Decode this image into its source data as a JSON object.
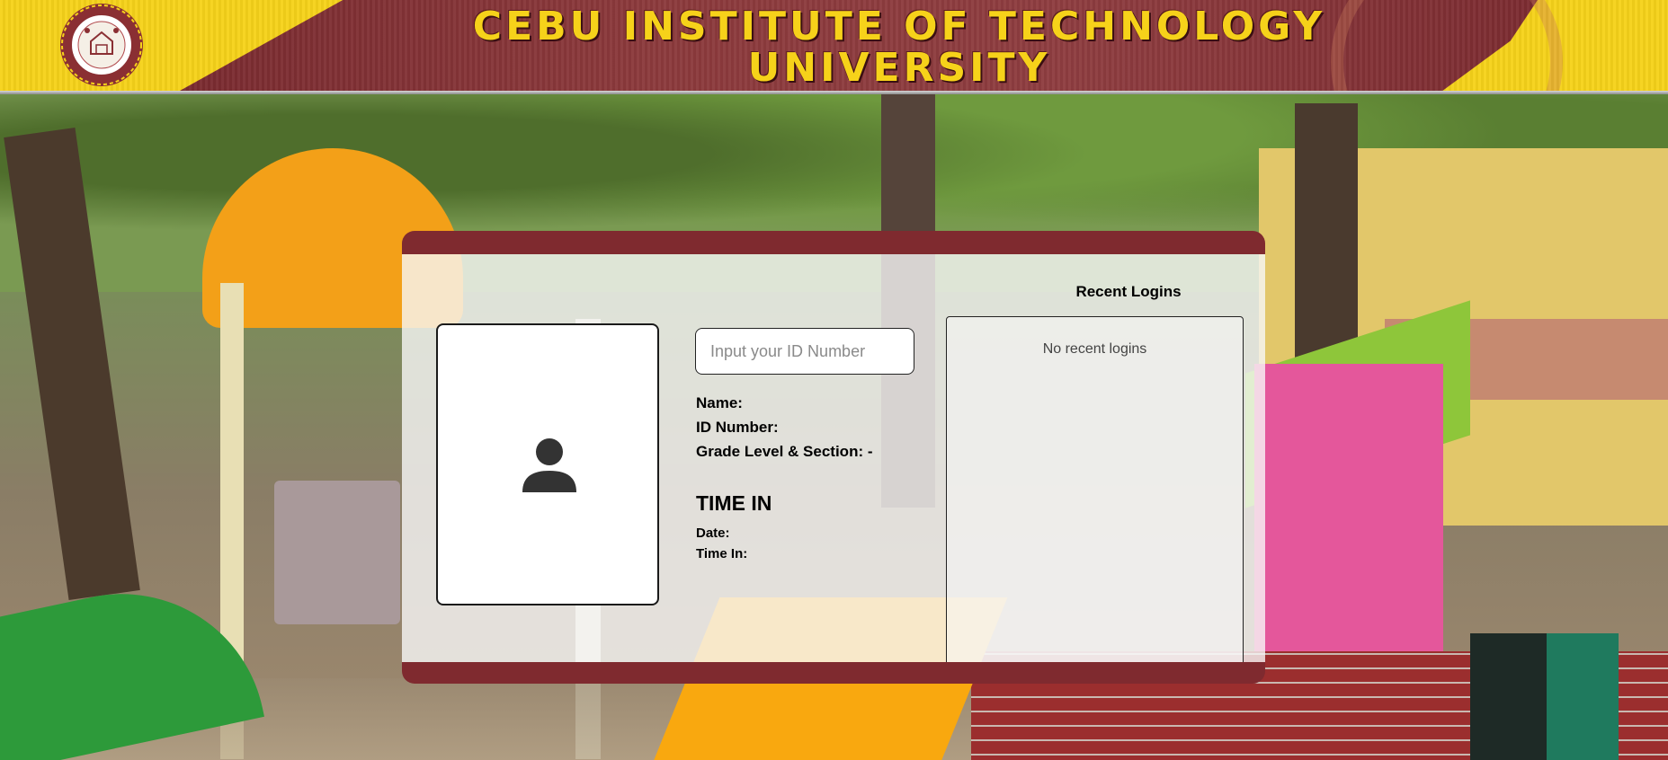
{
  "banner": {
    "title_line1": "CEBU INSTITUTE OF TECHNOLOGY",
    "title_line2": "UNIVERSITY",
    "logo_text_top": "CEBU INSTITUTE OF TECHNOLOGY",
    "logo_text_bottom": "UNIVERSITY",
    "logo_icon": "school-seal-icon"
  },
  "colors": {
    "accent_maroon": "#7f2a2f",
    "banner_yellow": "#f6d21a"
  },
  "profile": {
    "photo_icon": "user-silhouette-icon"
  },
  "id_input": {
    "placeholder": "Input your ID Number",
    "value": ""
  },
  "student": {
    "name_label": "Name:",
    "name_value": "",
    "id_label": "ID Number:",
    "id_value": "",
    "grade_label": "Grade Level & Section:",
    "grade_value": " -"
  },
  "time_in": {
    "heading": "TIME IN",
    "date_label": "Date:",
    "date_value": "",
    "time_label": "Time In:",
    "time_value": ""
  },
  "recent_logins": {
    "title": "Recent Logins",
    "empty_message": "No recent logins",
    "items": []
  }
}
